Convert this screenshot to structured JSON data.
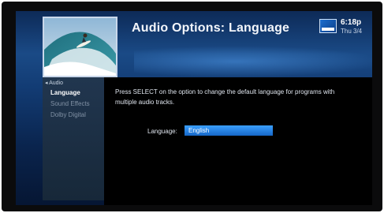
{
  "header": {
    "title": "Audio Options: Language",
    "time": "6:18p",
    "date": "Thu 3/4"
  },
  "sidebar": {
    "breadcrumb": "◂ Audio",
    "items": [
      {
        "label": "Language"
      },
      {
        "label": "Sound Effects"
      },
      {
        "label": "Dolby Digital"
      }
    ]
  },
  "content": {
    "instructions": "Press SELECT on the option to change the default language for programs with multiple audio tracks.",
    "language_label": "Language:",
    "language_value": "English"
  },
  "colors": {
    "accent_blue": "#1d7fe6",
    "background_black": "#000000",
    "header_blue": "#1a4a86"
  },
  "icons": [
    "directv-logo-icon",
    "breadcrumb-back-icon"
  ]
}
